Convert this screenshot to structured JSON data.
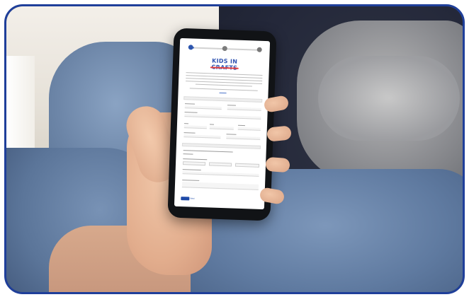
{
  "logo": {
    "text": "KIDS IN CRAFTS"
  },
  "form": {
    "submit_label": "Next"
  },
  "progress": {
    "current_step": 1,
    "total_steps": 3
  },
  "colors": {
    "frame_border": "#1f3f9a",
    "brand_blue": "#1e4aa8",
    "brand_red": "#e23b3b"
  }
}
